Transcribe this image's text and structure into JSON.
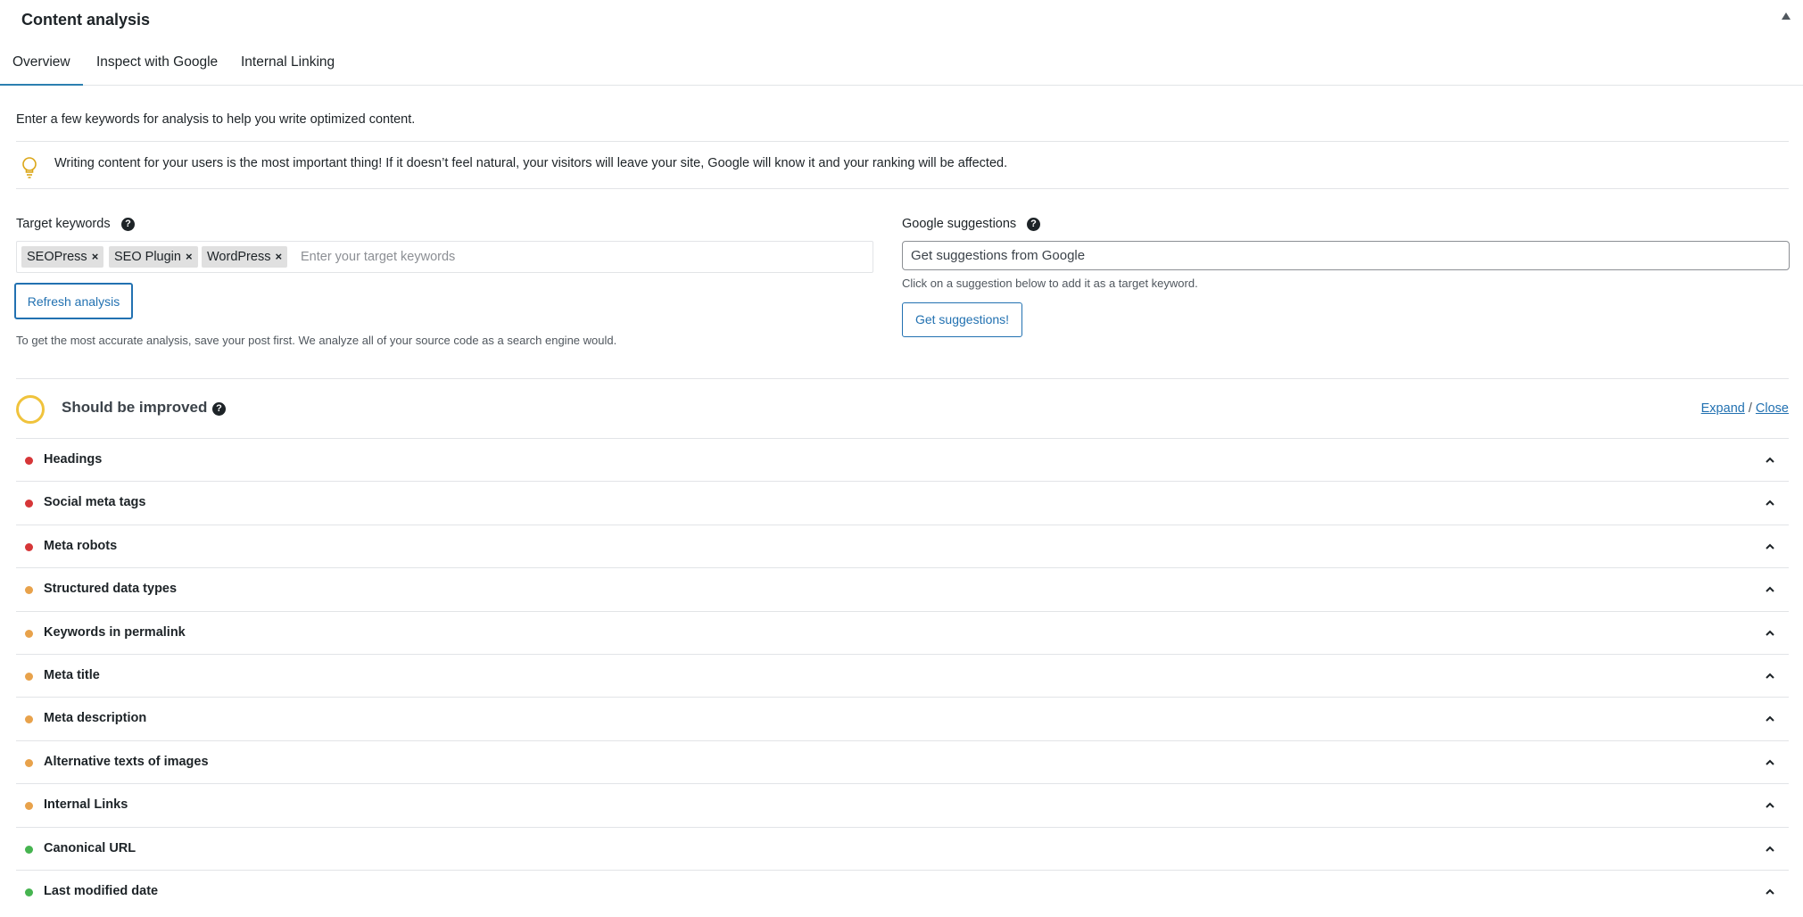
{
  "header": {
    "title": "Content analysis",
    "toggle_icon": "triangle-up-icon"
  },
  "tabs": [
    {
      "label": "Overview",
      "active": true
    },
    {
      "label": "Inspect with Google",
      "active": false
    },
    {
      "label": "Internal Linking",
      "active": false
    }
  ],
  "intro": "Enter a few keywords for analysis to help you write optimized content.",
  "tip": {
    "icon": "lightbulb-icon",
    "text": "Writing content for your users is the most important thing! If it doesn’t feel natural, your visitors will leave your site, Google will know it and your ranking will be affected."
  },
  "target_keywords": {
    "label": "Target keywords",
    "tags": [
      "SEOPress",
      "SEO Plugin",
      "WordPress"
    ],
    "remove_glyph": "×",
    "placeholder": "Enter your target keywords",
    "refresh_label": "Refresh analysis",
    "note": "To get the most accurate analysis, save your post first. We analyze all of your source code as a search engine would."
  },
  "google_suggestions": {
    "label": "Google suggestions",
    "input_value": "Get suggestions from Google",
    "hint": "Click on a suggestion below to add it as a target keyword.",
    "button_label": "Get suggestions!"
  },
  "score": {
    "label": "Should be improved",
    "ring_color": "#f0c33c",
    "expand_label": "Expand",
    "separator": "/",
    "close_label": "Close"
  },
  "help_glyph": "?",
  "status_colors": {
    "bad": "#d63638",
    "warning": "#e8a24b",
    "good": "#46b450"
  },
  "checks": [
    {
      "label": "Headings",
      "status": "bad"
    },
    {
      "label": "Social meta tags",
      "status": "bad"
    },
    {
      "label": "Meta robots",
      "status": "bad"
    },
    {
      "label": "Structured data types",
      "status": "warning"
    },
    {
      "label": "Keywords in permalink",
      "status": "warning"
    },
    {
      "label": "Meta title",
      "status": "warning"
    },
    {
      "label": "Meta description",
      "status": "warning"
    },
    {
      "label": "Alternative texts of images",
      "status": "warning"
    },
    {
      "label": "Internal Links",
      "status": "warning"
    },
    {
      "label": "Canonical URL",
      "status": "good"
    },
    {
      "label": "Last modified date",
      "status": "good"
    }
  ]
}
